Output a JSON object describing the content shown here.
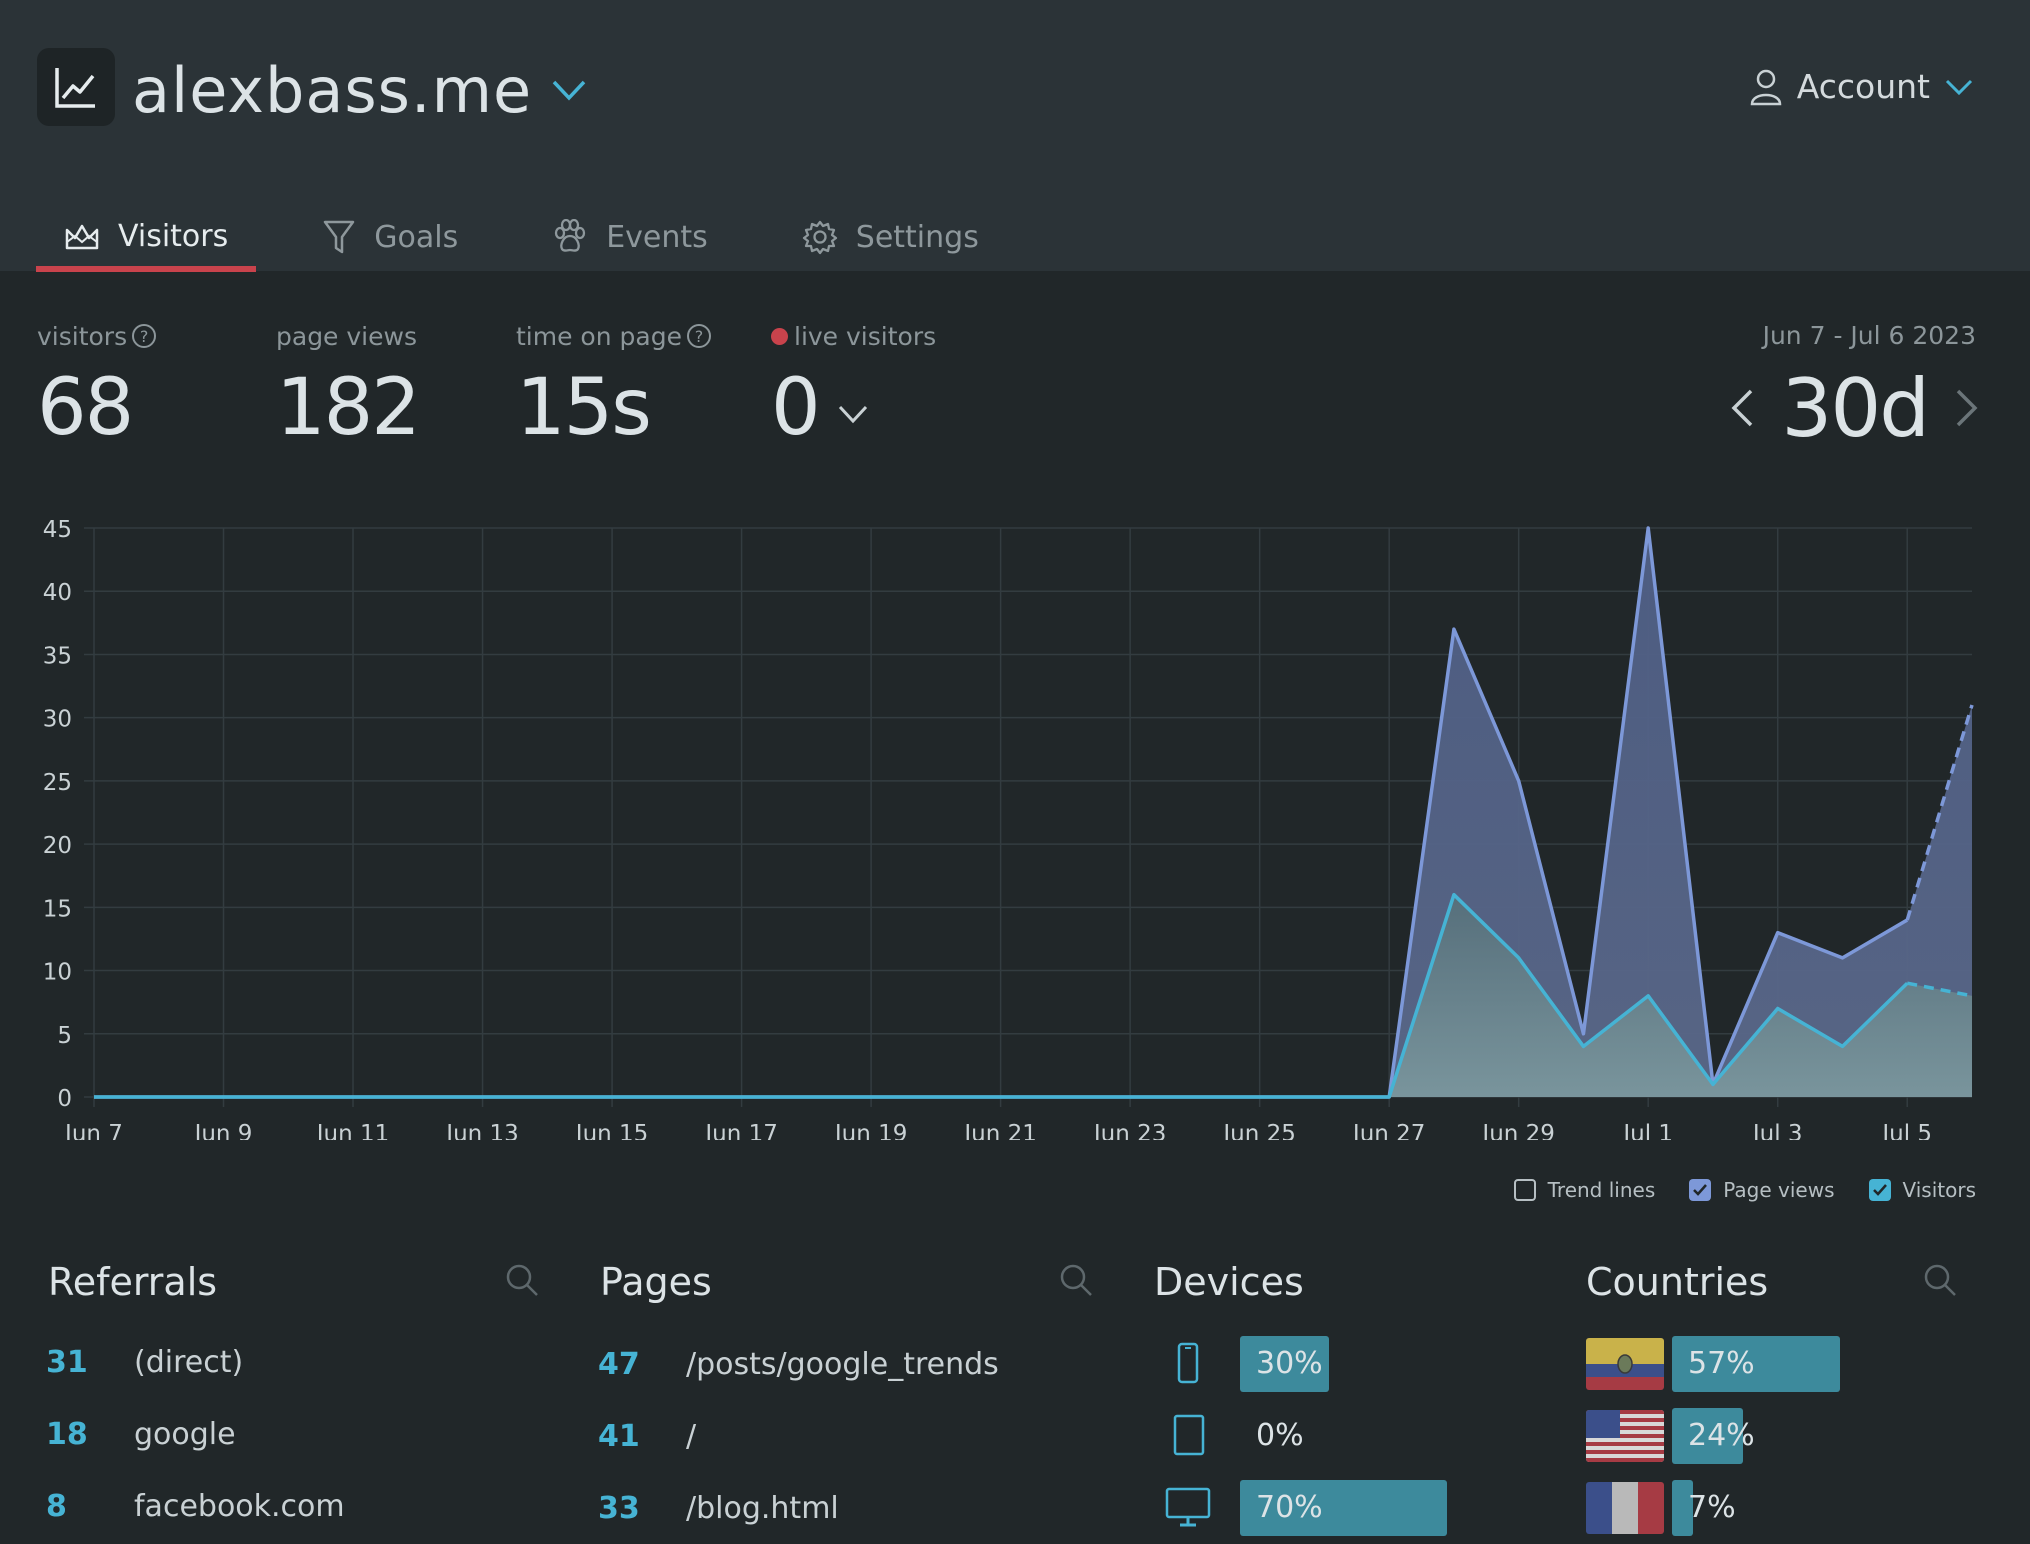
{
  "site": {
    "name": "alexbass.me"
  },
  "account": {
    "label": "Account"
  },
  "tabs": [
    {
      "label": "Visitors",
      "active": true,
      "icon": "crown-icon"
    },
    {
      "label": "Goals",
      "active": false,
      "icon": "funnel-icon"
    },
    {
      "label": "Events",
      "active": false,
      "icon": "paw-icon"
    },
    {
      "label": "Settings",
      "active": false,
      "icon": "gear-icon"
    }
  ],
  "stats": {
    "visitors": {
      "label": "visitors",
      "value": "68"
    },
    "page_views": {
      "label": "page views",
      "value": "182"
    },
    "time_on_page": {
      "label": "time on page",
      "value": "15s"
    },
    "live_visitors": {
      "label": "live visitors",
      "value": "0"
    }
  },
  "range": {
    "dates": "Jun 7 - Jul 6 2023",
    "value": "30d"
  },
  "chart_data": {
    "type": "area",
    "x": [
      "Jun 7",
      "Jun 8",
      "Jun 9",
      "Jun 10",
      "Jun 11",
      "Jun 12",
      "Jun 13",
      "Jun 14",
      "Jun 15",
      "Jun 16",
      "Jun 17",
      "Jun 18",
      "Jun 19",
      "Jun 20",
      "Jun 21",
      "Jun 22",
      "Jun 23",
      "Jun 24",
      "Jun 25",
      "Jun 26",
      "Jun 27",
      "Jun 28",
      "Jun 29",
      "Jun 30",
      "Jul 1",
      "Jul 2",
      "Jul 3",
      "Jul 4",
      "Jul 5",
      "Jul 6"
    ],
    "x_tick_labels": [
      "Jun 7",
      "Jun 9",
      "Jun 11",
      "Jun 13",
      "Jun 15",
      "Jun 17",
      "Jun 19",
      "Jun 21",
      "Jun 23",
      "Jun 25",
      "Jun 27",
      "Jun 29",
      "Jul 1",
      "Jul 3",
      "Jul 5"
    ],
    "y_ticks": [
      0,
      5,
      10,
      15,
      20,
      25,
      30,
      35,
      40,
      45
    ],
    "ylim": [
      0,
      45
    ],
    "series": [
      {
        "name": "Page views",
        "color": "#7d98d8",
        "values": [
          0,
          0,
          0,
          0,
          0,
          0,
          0,
          0,
          0,
          0,
          0,
          0,
          0,
          0,
          0,
          0,
          0,
          0,
          0,
          0,
          0,
          37,
          25,
          5,
          45,
          1,
          13,
          11,
          14,
          31
        ],
        "partial_last": true
      },
      {
        "name": "Visitors",
        "color": "#46b3d4",
        "values": [
          0,
          0,
          0,
          0,
          0,
          0,
          0,
          0,
          0,
          0,
          0,
          0,
          0,
          0,
          0,
          0,
          0,
          0,
          0,
          0,
          0,
          16,
          11,
          4,
          8,
          1,
          7,
          4,
          9,
          8
        ],
        "partial_last": true
      }
    ],
    "grid": true
  },
  "legend": {
    "trend": "Trend lines",
    "page_views": "Page views",
    "visitors": "Visitors"
  },
  "referrals": {
    "title": "Referrals",
    "rows": [
      {
        "count": "31",
        "label": "(direct)"
      },
      {
        "count": "18",
        "label": "google"
      },
      {
        "count": "8",
        "label": "facebook.com"
      }
    ]
  },
  "pages": {
    "title": "Pages",
    "rows": [
      {
        "count": "47",
        "label": "/posts/google_trends"
      },
      {
        "count": "41",
        "label": "/"
      },
      {
        "count": "33",
        "label": "/blog.html"
      }
    ]
  },
  "devices": {
    "title": "Devices",
    "rows": [
      {
        "icon": "phone-icon",
        "percent": "30%",
        "fraction": 0.3
      },
      {
        "icon": "tablet-icon",
        "percent": "0%",
        "fraction": 0
      },
      {
        "icon": "desktop-icon",
        "percent": "70%",
        "fraction": 0.7
      }
    ]
  },
  "countries": {
    "title": "Countries",
    "rows": [
      {
        "flag": "ecuador-flag-icon",
        "percent": "57%",
        "fraction": 0.57
      },
      {
        "flag": "usa-flag-icon",
        "percent": "24%",
        "fraction": 0.24
      },
      {
        "flag": "france-flag-icon",
        "percent": "7%",
        "fraction": 0.07
      }
    ]
  }
}
